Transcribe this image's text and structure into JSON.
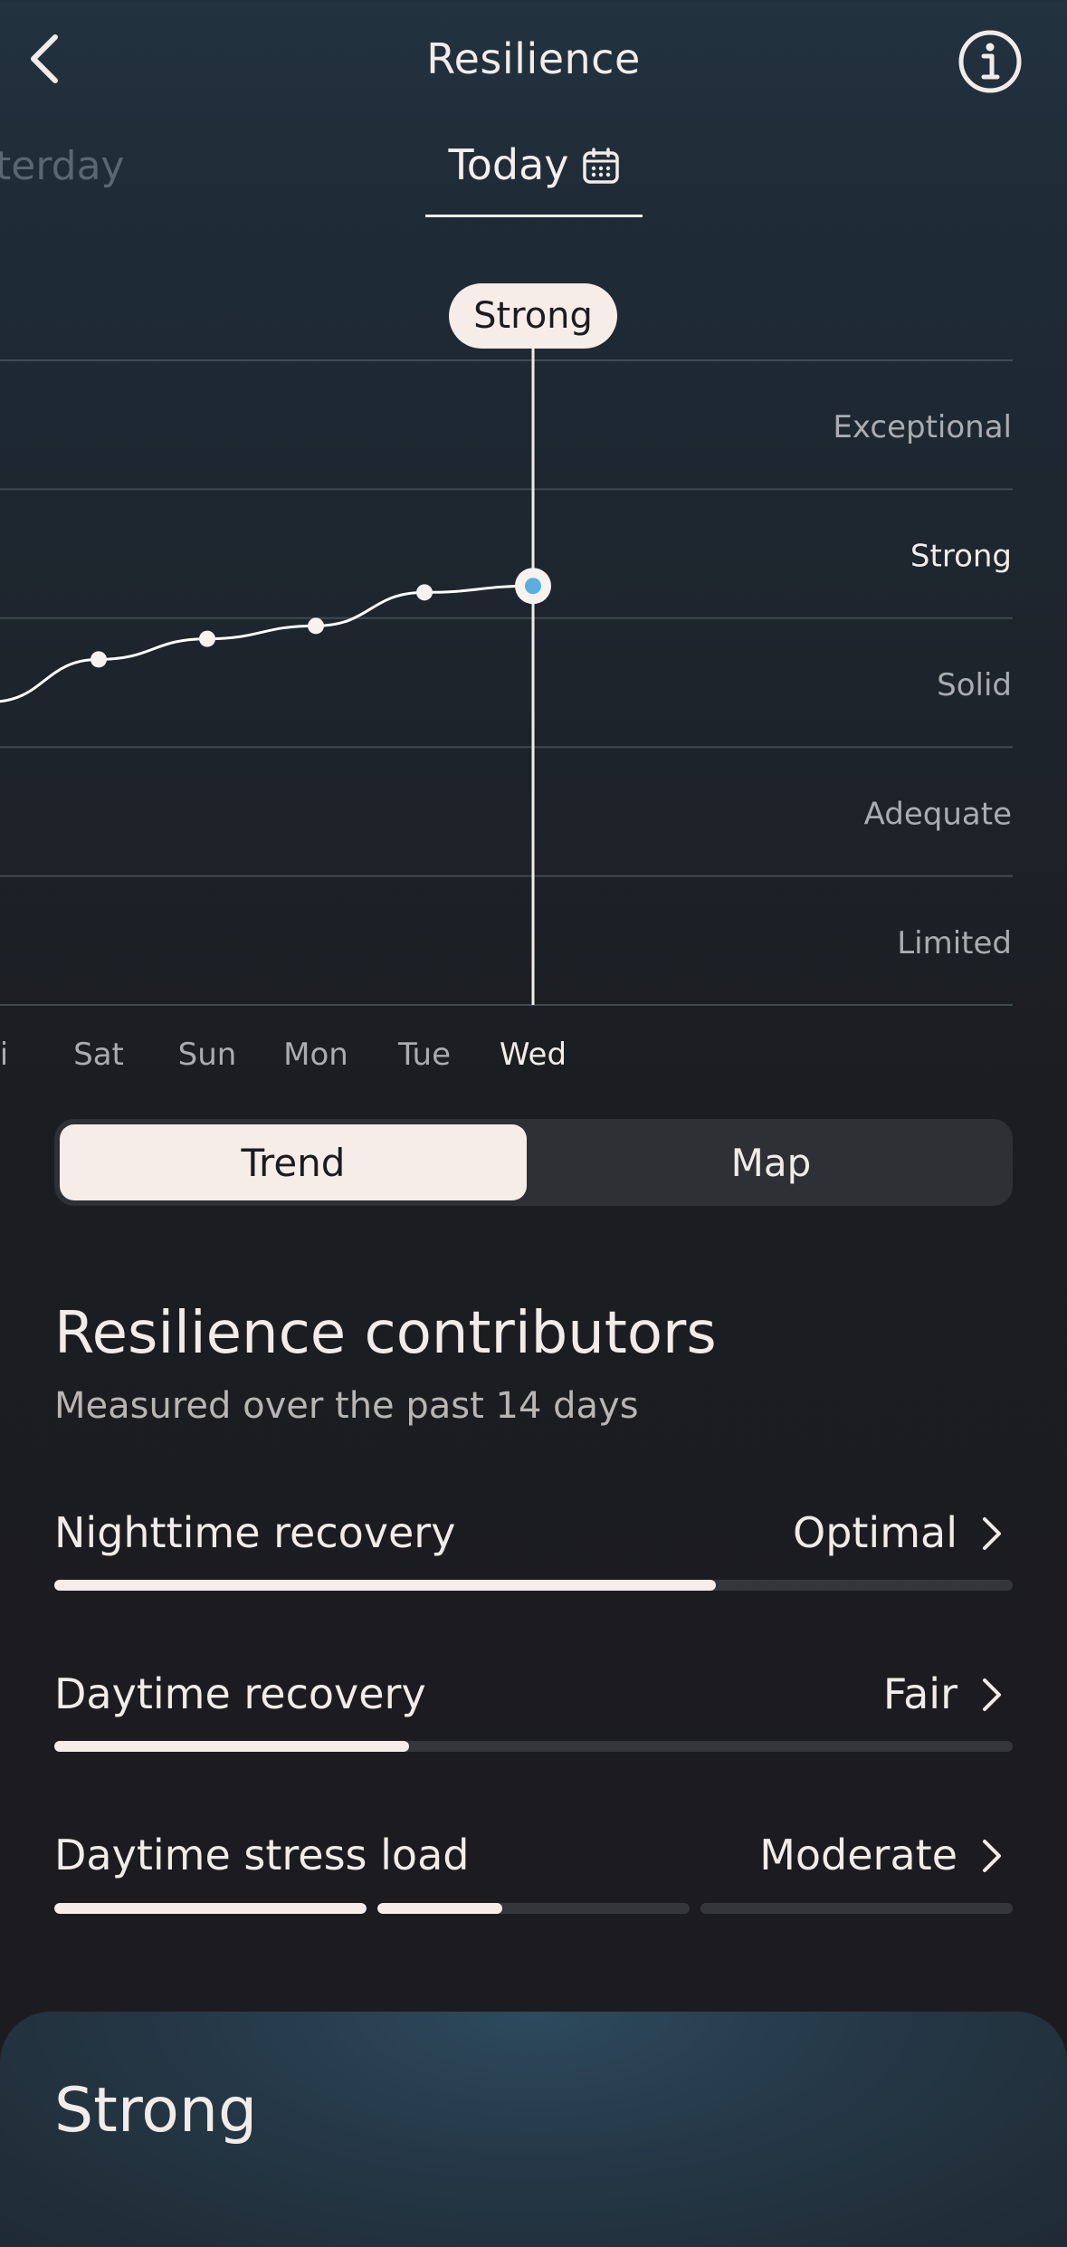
{
  "header": {
    "title": "Resilience",
    "back_icon": "chevron-left-icon",
    "info_icon": "info-icon"
  },
  "date_tabs": {
    "previous_label": "Yesterday",
    "current_label": "Today",
    "calendar_icon": "calendar-icon"
  },
  "chart_data": {
    "type": "line",
    "x": [
      "Fri",
      "Sat",
      "Sun",
      "Mon",
      "Tue",
      "Wed"
    ],
    "levels": [
      "Limited",
      "Adequate",
      "Solid",
      "Strong",
      "Exceptional"
    ],
    "values": [
      2.35,
      2.68,
      2.84,
      2.94,
      3.2,
      3.25
    ],
    "selected": {
      "x": "Wed",
      "label": "Strong"
    },
    "grid": true,
    "colors": {
      "line": "#ffffff",
      "selected_point": "#5aaee0",
      "selected_label_bg": "#f6ece8"
    }
  },
  "view_toggle": {
    "options": [
      "Trend",
      "Map"
    ],
    "selected": "Trend"
  },
  "contributors": {
    "title": "Resilience contributors",
    "subtitle": "Measured over the past 14 days",
    "items": [
      {
        "label": "Nighttime recovery",
        "value": "Optimal",
        "level": 0.69
      },
      {
        "label": "Daytime recovery",
        "value": "Fair",
        "level": 0.37
      },
      {
        "label": "Daytime stress load",
        "value": "Moderate",
        "segments": [
          1.0,
          0.4,
          0.0
        ]
      }
    ]
  },
  "summary_card": {
    "title": "Strong"
  }
}
